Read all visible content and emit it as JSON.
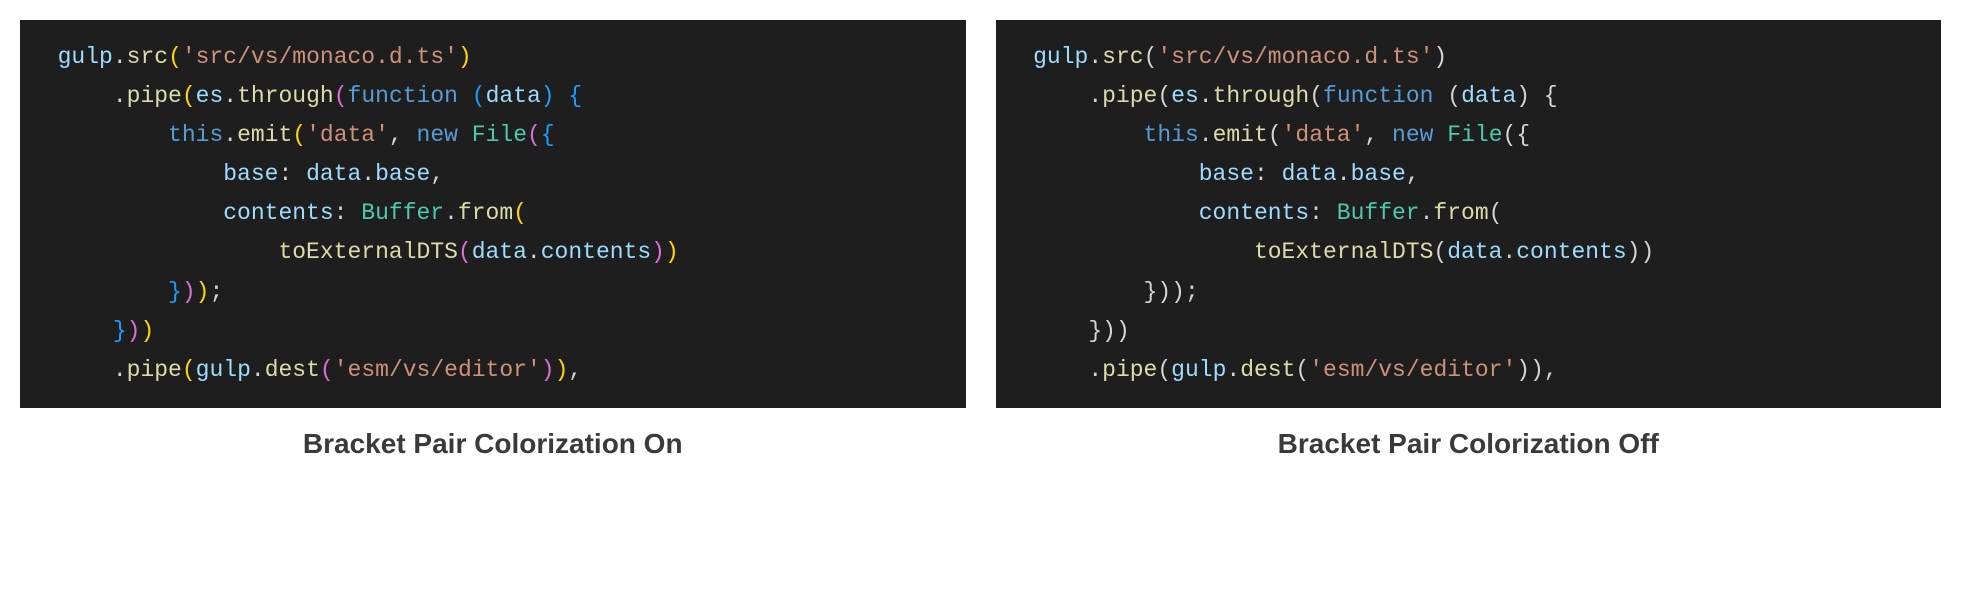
{
  "captions": {
    "on": "Bracket Pair Colorization On",
    "off": "Bracket Pair Colorization Off"
  },
  "code": {
    "line1": {
      "ident": "gulp",
      "dot": ".",
      "method": "src",
      "str": "'src/vs/monaco.d.ts'"
    },
    "line2": {
      "dot": ".",
      "method": "pipe",
      "ident": "es",
      "dot2": ".",
      "method2": "through",
      "kw": "function",
      "param": "data"
    },
    "line3": {
      "this": "this",
      "dot": ".",
      "method": "emit",
      "str": "'data'",
      "comma": ",",
      "kw": "new",
      "cls": "File"
    },
    "line4": {
      "prop": "base",
      "colon": ":",
      "ident": "data",
      "dot": ".",
      "prop2": "base",
      "comma": ","
    },
    "line5": {
      "prop": "contents",
      "colon": ":",
      "cls": "Buffer",
      "dot": ".",
      "method": "from"
    },
    "line6": {
      "method": "toExternalDTS",
      "ident": "data",
      "dot": ".",
      "prop": "contents"
    },
    "line9": {
      "dot": ".",
      "method": "pipe",
      "ident": "gulp",
      "dot2": ".",
      "method2": "dest",
      "str": "'esm/vs/editor'"
    }
  }
}
